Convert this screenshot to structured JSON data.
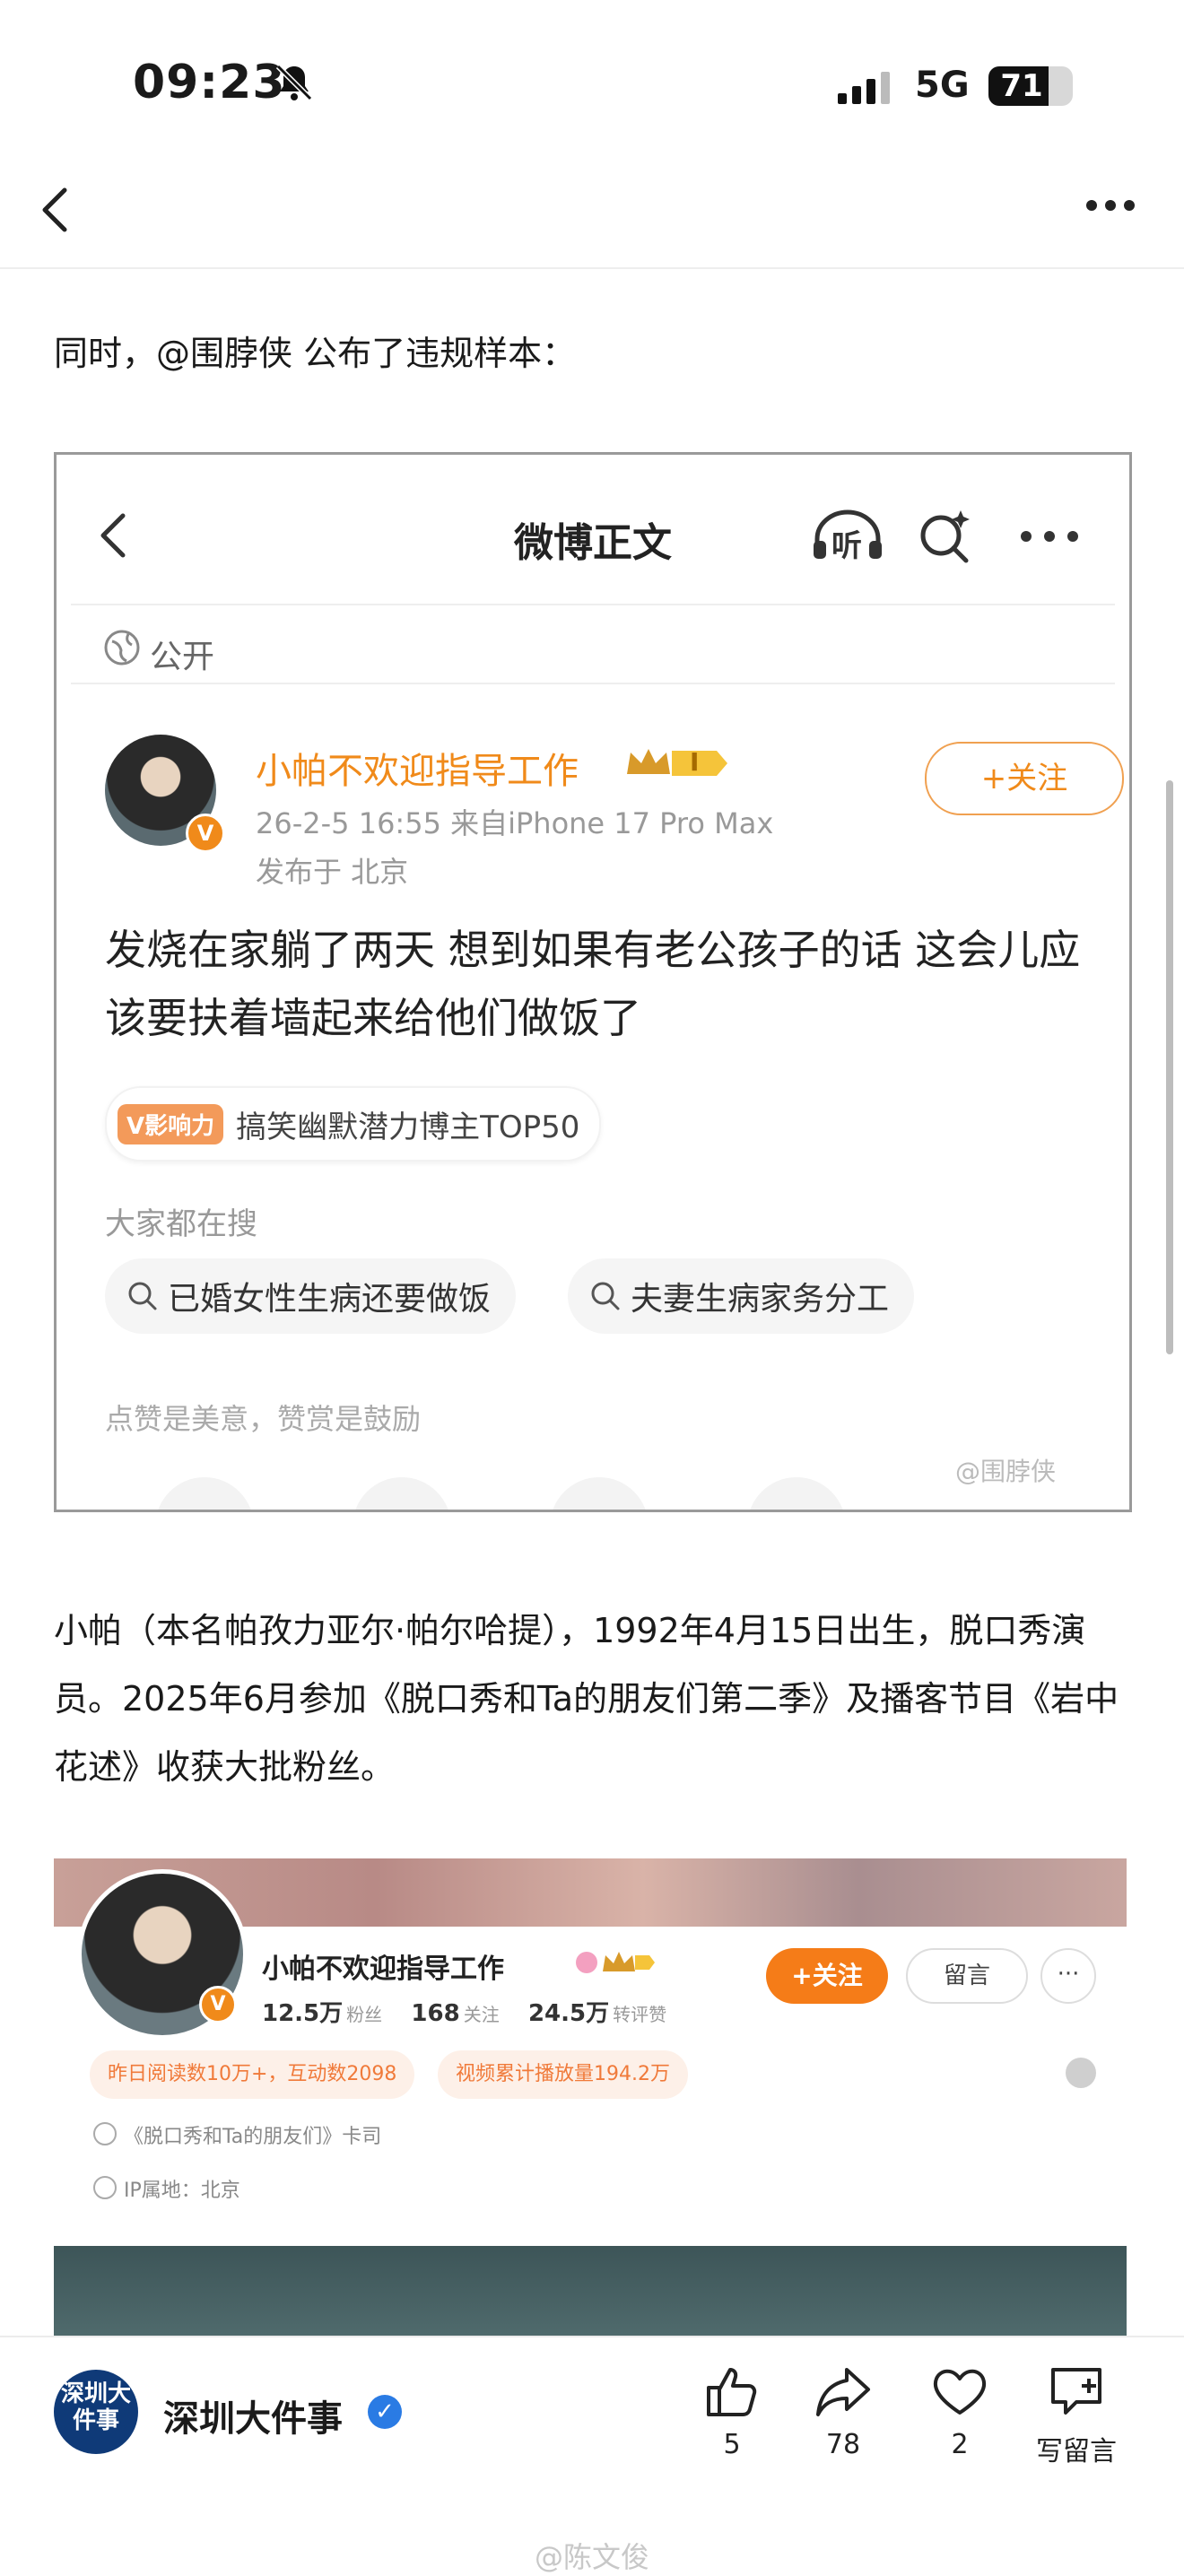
{
  "status_bar": {
    "time": "09:23",
    "network": "5G",
    "battery_percent": 71,
    "battery_label": "71"
  },
  "article": {
    "intro": "同时，@围脖侠 公布了违规样本：",
    "paragraph": "小帕（本名帕孜力亚尔·帕尔哈提），1992年4月15日出生，脱口秀演员。2025年6月参加《脱口秀和Ta的朋友们第二季》及播客节目《岩中花述》收获大批粉丝。"
  },
  "embedded_post": {
    "header_title": "微博正文",
    "listen_label": "听",
    "visibility": "公开",
    "author_name": "小帕不欢迎指导工作",
    "author_badge": "V",
    "level_label": "I",
    "post_meta": "26-2-5 16:55  来自iPhone 17 Pro Max",
    "post_location": "发布于 北京",
    "follow_label": "+关注",
    "content": "发烧在家躺了两天 想到如果有老公孩子的话 这会儿应该要扶着墙起来给他们做饭了",
    "influence_badge": "V影响力",
    "influence_text": "搞笑幽默潜力博主TOP50",
    "search_label": "大家都在搜",
    "search_pills": [
      "已婚女性生病还要做饭",
      "夫妻生病家务分工"
    ],
    "praise_text": "点赞是美意，赞赏是鼓励",
    "watermark": "@围脖侠"
  },
  "profile_card": {
    "name": "小帕不欢迎指导工作",
    "avatar_badge": "V",
    "followers_value": "12.5万",
    "followers_unit": "粉丝",
    "following_value": "168",
    "following_unit": "关注",
    "likes_value": "24.5万",
    "likes_unit": "转评赞",
    "follow_label": "+关注",
    "message_label": "留言",
    "more_label": "···",
    "chip_reads": "昨日阅读数10万+，互动数2098",
    "chip_video": "视频累计播放量194.2万",
    "work_label": "《脱口秀和Ta的朋友们》卡司",
    "ip_label": "IP属地：北京"
  },
  "bottom_bar": {
    "account_name": "深圳大件事",
    "logo_text": "深圳大件事",
    "like_count": "5",
    "share_count": "78",
    "heart_count": "2",
    "comment_label": "写留言",
    "watermark": "@陈文俊"
  },
  "colors": {
    "weibo_orange": "#f08a1a",
    "verified_blue": "#2a7be4"
  }
}
